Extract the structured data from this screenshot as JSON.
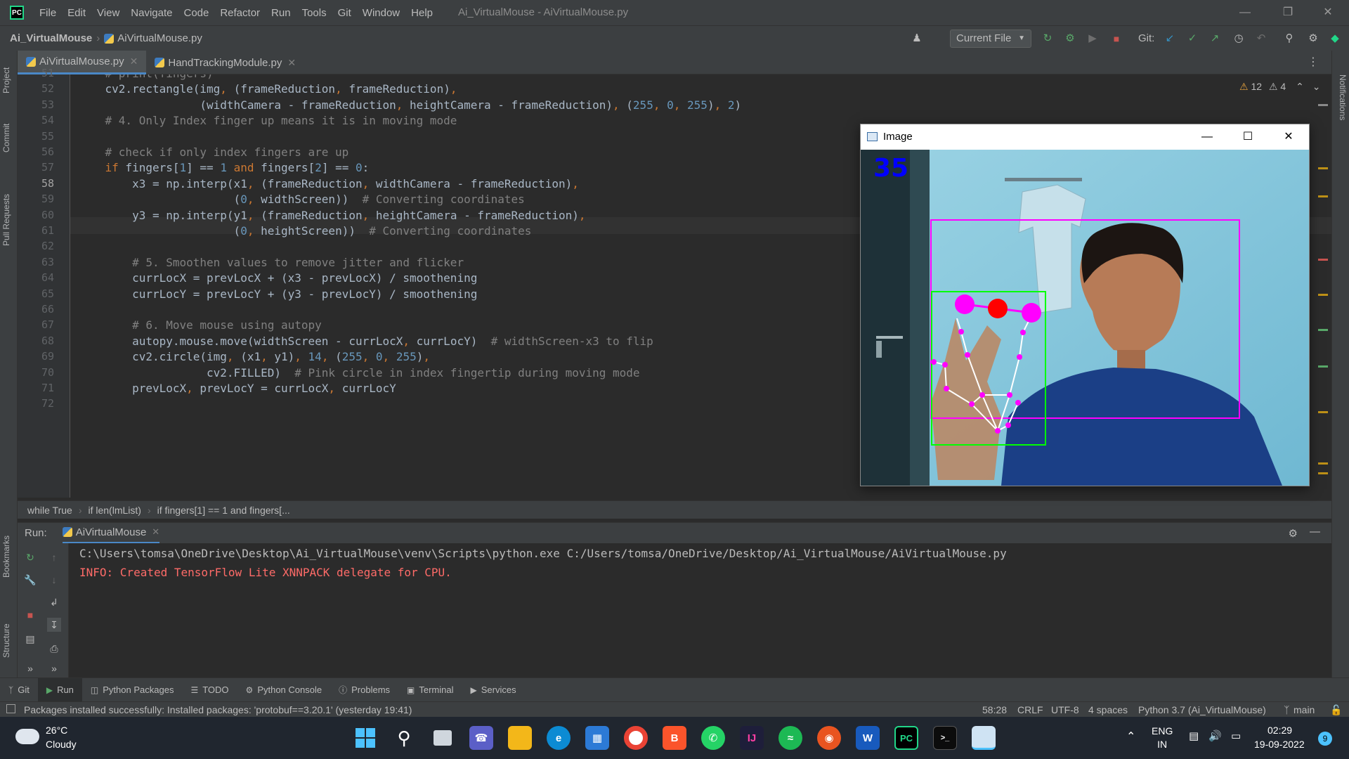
{
  "window_title": "Ai_VirtualMouse - AiVirtualMouse.py",
  "menu": [
    "File",
    "Edit",
    "View",
    "Navigate",
    "Code",
    "Refactor",
    "Run",
    "Tools",
    "Git",
    "Window",
    "Help"
  ],
  "nav": {
    "project": "Ai_VirtualMouse",
    "file": "AiVirtualMouse.py",
    "run_config": "Current File",
    "git_label": "Git:"
  },
  "left_tabs": [
    "Project",
    "Commit",
    "Pull Requests",
    "Bookmarks",
    "Structure"
  ],
  "right_tabs": [
    "Notifications"
  ],
  "editor_tabs": [
    {
      "label": "AiVirtualMouse.py",
      "active": true
    },
    {
      "label": "HandTrackingModule.py",
      "active": false
    }
  ],
  "inspections": {
    "warnings": "12",
    "weak_warnings": "4"
  },
  "line_numbers": [
    "51",
    "52",
    "53",
    "54",
    "55",
    "56",
    "57",
    "58",
    "59",
    "60",
    "61",
    "62",
    "63",
    "64",
    "65",
    "66",
    "67",
    "68",
    "69",
    "70",
    "71",
    "72"
  ],
  "code_lines": [
    "    # print(fingers)",
    "    cv2.rectangle(img, (frameReduction, frameReduction),",
    "                  (widthCamera - frameReduction, heightCamera - frameReduction), (255, 0, 255), 2)",
    "    # 4. Only Index finger up means it is in moving mode",
    "",
    "    # check if only index fingers are up",
    "    if fingers[1] == 1 and fingers[2] == 0:",
    "        x3 = np.interp(x1, (frameReduction, widthCamera - frameReduction),",
    "                       (0, widthScreen))  # Converting coordinates",
    "        y3 = np.interp(y1, (frameReduction, heightCamera - frameReduction),",
    "                       (0, heightScreen))  # Converting coordinates",
    "",
    "        # 5. Smoothen values to remove jitter and flicker",
    "        currLocX = prevLocX + (x3 - prevLocX) / smoothening",
    "        currLocY = prevLocY + (y3 - prevLocY) / smoothening",
    "",
    "        # 6. Move mouse using autopy",
    "        autopy.mouse.move(widthScreen - currLocX, currLocY)  # widthScreen-x3 to flip",
    "        cv2.circle(img, (x1, y1), 14, (255, 0, 255),",
    "                   cv2.FILLED)  # Pink circle in index fingertip during moving mode",
    "        prevLocX, prevLocY = currLocX, currLocY",
    ""
  ],
  "code_breadcrumbs": [
    "while True",
    "if len(lmList)",
    "if fingers[1] == 1 and fingers[..."
  ],
  "run_panel": {
    "label": "Run:",
    "config": "AiVirtualMouse",
    "console": [
      {
        "text": "C:\\Users\\tomsa\\OneDrive\\Desktop\\Ai_VirtualMouse\\venv\\Scripts\\python.exe C:/Users/tomsa/OneDrive/Desktop/Ai_VirtualMouse/AiVirtualMouse.py",
        "kind": "normal"
      },
      {
        "text": "INFO: Created TensorFlow Lite XNNPACK delegate for CPU.",
        "kind": "error"
      }
    ]
  },
  "bottom_tools": [
    "Git",
    "Run",
    "Python Packages",
    "TODO",
    "Python Console",
    "Problems",
    "Terminal",
    "Services"
  ],
  "status": {
    "message": "Packages installed successfully: Installed packages: 'protobuf==3.20.1' (yesterday 19:41)",
    "position": "58:28",
    "line_sep": "CRLF",
    "encoding": "UTF-8",
    "indent": "4 spaces",
    "interpreter": "Python 3.7 (Ai_VirtualMouse)",
    "branch": "main"
  },
  "image_window": {
    "title": "Image",
    "fps": "35"
  },
  "taskbar": {
    "temp": "26°C",
    "condition": "Cloudy",
    "lang1": "ENG",
    "lang2": "IN",
    "time": "02:29",
    "date": "19-09-2022",
    "notif_count": "9"
  },
  "colors": {
    "accent": "#4a88c7",
    "error_text": "#ff6b68",
    "editor_bg": "#2b2b2b",
    "panel_bg": "#3c3f41",
    "magenta": "#ff00ff",
    "green": "#00ff00"
  }
}
